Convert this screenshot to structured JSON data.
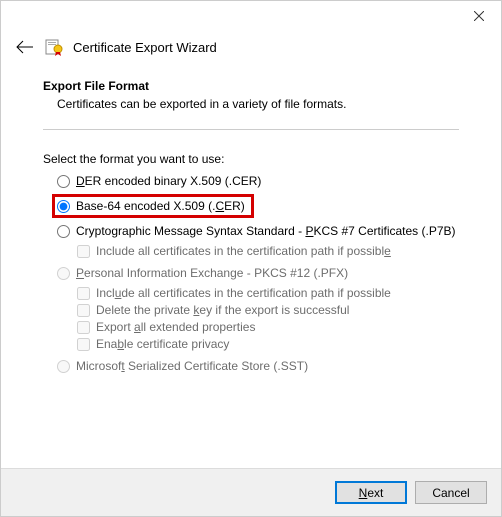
{
  "window": {
    "title": "Certificate Export Wizard"
  },
  "section": {
    "title": "Export File Format",
    "description": "Certificates can be exported in a variety of file formats.",
    "prompt": "Select the format you want to use:"
  },
  "options": {
    "der": {
      "pre": "",
      "accel": "D",
      "post": "ER encoded binary X.509 (.CER)"
    },
    "base64": {
      "pre": "Base-64 encoded X.509 (.",
      "accel": "C",
      "post": "ER)"
    },
    "pkcs7": {
      "pre": "Cryptographic Message Syntax Standard - ",
      "accel": "P",
      "post": "KCS #7 Certificates (.P7B)"
    },
    "pkcs7_include": {
      "pre": "Include all certificates in the certification path if possibl",
      "accel": "e",
      "post": ""
    },
    "pfx": {
      "pre": "",
      "accel": "P",
      "post": "ersonal Information Exchange - PKCS #12 (.PFX)"
    },
    "pfx_include": {
      "pre": "Incl",
      "accel": "u",
      "post": "de all certificates in the certification path if possible"
    },
    "pfx_delete": {
      "pre": "Delete the private ",
      "accel": "k",
      "post": "ey if the export is successful"
    },
    "pfx_extprops": {
      "pre": "Export ",
      "accel": "a",
      "post": "ll extended properties"
    },
    "pfx_privacy": {
      "pre": "Ena",
      "accel": "b",
      "post": "le certificate privacy"
    },
    "sst": {
      "pre": "Microsof",
      "accel": "t",
      "post": " Serialized Certificate Store (.SST)"
    }
  },
  "buttons": {
    "next_pre": "",
    "next_accel": "N",
    "next_post": "ext",
    "cancel": "Cancel"
  }
}
